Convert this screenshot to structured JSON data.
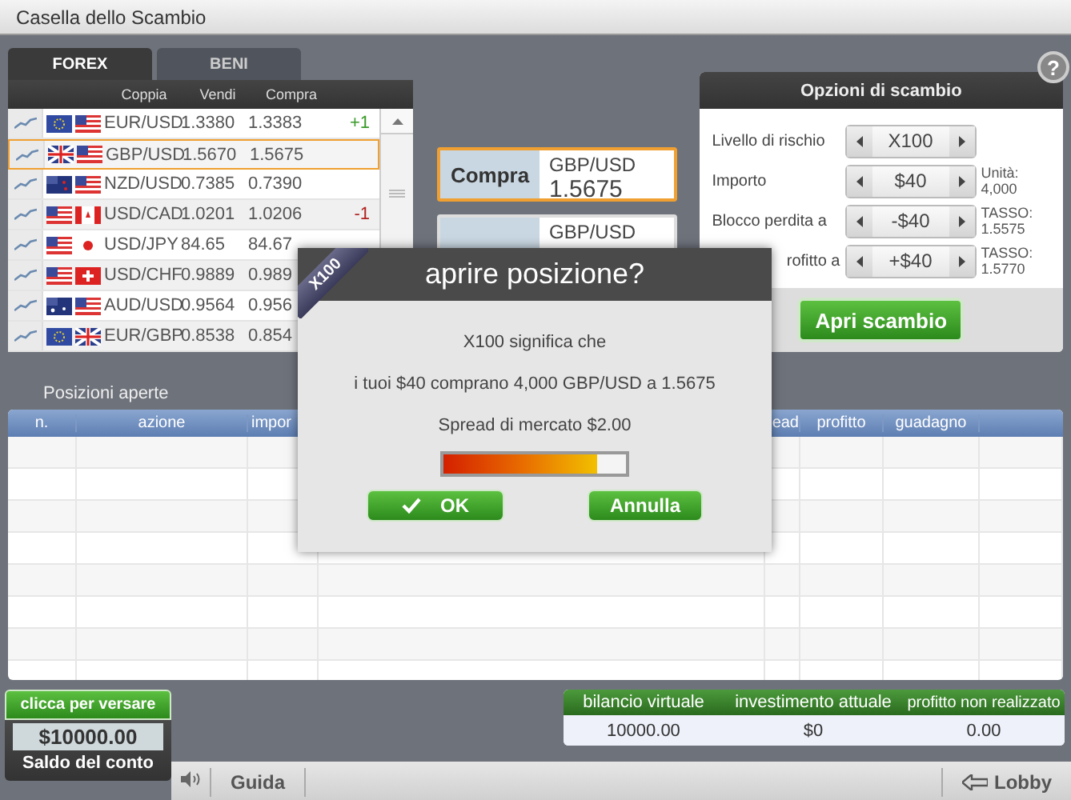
{
  "window": {
    "title": "Casella dello Scambio"
  },
  "market_tabs": [
    {
      "label": "FOREX",
      "selected": true
    },
    {
      "label": "BENI",
      "selected": false
    }
  ],
  "quotes": {
    "columns": [
      "Coppia",
      "Vendi",
      "Compra"
    ],
    "rows": [
      {
        "flags": [
          {
            "kind": "eu"
          },
          {
            "kind": "us"
          }
        ],
        "pair": "EUR/USD",
        "sell": "1.3380",
        "buy": "1.3383",
        "change": "+1",
        "color": "#3a9a2a",
        "selected": false
      },
      {
        "flags": [
          {
            "kind": "gb"
          },
          {
            "kind": "us"
          }
        ],
        "pair": "GBP/USD",
        "sell": "1.5670",
        "buy": "1.5675",
        "selected": true
      },
      {
        "flags": [
          {
            "kind": "nz"
          },
          {
            "kind": "us"
          }
        ],
        "pair": "NZD/USD",
        "sell": "0.7385",
        "buy": "0.7390",
        "selected": false
      },
      {
        "flags": [
          {
            "kind": "us"
          },
          {
            "kind": "ca"
          }
        ],
        "pair": "USD/CAD",
        "sell": "1.0201",
        "buy": "1.0206",
        "change": "-1",
        "color": "#b22222",
        "selected": false
      },
      {
        "flags": [
          {
            "kind": "us"
          },
          {
            "kind": "jp"
          }
        ],
        "pair": "USD/JPY",
        "sell": "84.65",
        "buy": "84.67",
        "selected": false
      },
      {
        "flags": [
          {
            "kind": "us"
          },
          {
            "kind": "ch"
          }
        ],
        "pair": "USD/CHF",
        "sell": "0.9889",
        "buy": "0.989",
        "selected": false
      },
      {
        "flags": [
          {
            "kind": "au"
          },
          {
            "kind": "us"
          }
        ],
        "pair": "AUD/USD",
        "sell": "0.9564",
        "buy": "0.956",
        "selected": false
      },
      {
        "flags": [
          {
            "kind": "eu"
          },
          {
            "kind": "gb"
          }
        ],
        "pair": "EUR/GBP",
        "sell": "0.8538",
        "buy": "0.854",
        "selected": false
      }
    ]
  },
  "trade_buttons": [
    {
      "label": "Compra",
      "pair": "GBP/USD",
      "price": "1.5675",
      "selected": true
    },
    {
      "pair": "GBP/USD",
      "selected": false
    }
  ],
  "help": {
    "label": "?"
  },
  "trade_options": {
    "title": "Opzioni di scambio",
    "rows": [
      {
        "label": "Livello di rischio",
        "value": "X100"
      },
      {
        "label": "Importo",
        "value": "$40",
        "note": [
          "Unità:",
          "4,000"
        ]
      },
      {
        "label": "Blocco perdita a",
        "value": "-$40",
        "note": [
          "TASSO:",
          "1.5575"
        ]
      },
      {
        "label": "rofitto a",
        "value": "+$40",
        "note": [
          "TASSO:",
          "1.5770"
        ]
      }
    ],
    "button": "Apri scambio"
  },
  "open_positions": {
    "title": "Posizioni aperte",
    "columns": [
      "n.",
      "azione",
      "impor",
      "ead",
      "profitto",
      "guadagno"
    ]
  },
  "dialog": {
    "ribbon": "X100",
    "title": "aprire posizione?",
    "lines": [
      "X100 significa che",
      "i tuoi $40 comprano 4,000 GBP/USD a 1.5675",
      "Spread di mercato $2.00"
    ],
    "spread_meter": {
      "level": 0.84
    },
    "ok": "OK",
    "cancel": "Annulla"
  },
  "deposit": {
    "button": "clicca per versare",
    "balance": "$10000.00",
    "label": "Saldo del conto"
  },
  "summary": {
    "columns": [
      "bilancio virtuale",
      "investimento attuale",
      "profitto non realizzato"
    ],
    "values": [
      "10000.00",
      "$0",
      "0.00"
    ]
  },
  "footer": {
    "help": "Guida",
    "lobby": "Lobby"
  }
}
